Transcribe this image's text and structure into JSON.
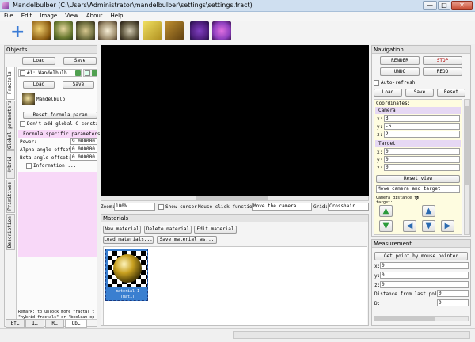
{
  "window": {
    "title": "Mandelbulber (C:\\Users\\Administrator\\mandelbulber\\settings\\settings.fract)",
    "btn_min": "—",
    "btn_max": "□",
    "btn_close": "✕"
  },
  "menu": [
    "File",
    "Edit",
    "Image",
    "View",
    "About",
    "Help"
  ],
  "toolbar": {
    "add_label": "+"
  },
  "objects": {
    "title": "Objects",
    "load": "Load",
    "save": "Save",
    "tabs_vertical": [
      "Fractals",
      "Global parameters",
      "Hybrid",
      "Primitives",
      "Description"
    ],
    "formula_tab1": "#1: Wandelbulb",
    "inner_load": "Load",
    "inner_save": "Save",
    "formula_name": "Mandelbulb",
    "reset_formula": "Reset formula param",
    "dont_add_global": "Don't add global C constant",
    "specific_title": "Formula specific parameters",
    "power_label": "Power:",
    "power_value": "9.000000",
    "alpha_label": "Alpha angle offset:",
    "alpha_value": "0.000000",
    "beta_label": "Beta angle offset:",
    "beta_value": "0.000000",
    "information": "Information ...",
    "remark": "Remark: to unlock more fractal t\n\"hybrid fractals\" or \"boolean op",
    "bottom_tabs": [
      "Ef…",
      "I…",
      "R…",
      "Ob…"
    ]
  },
  "render": {
    "zoom_label": "Zoom:",
    "zoom_value": "100%",
    "show_cursor": "Show cursor",
    "mouse_click_label": "Mouse click function:",
    "mouse_click_value": "Move the camera",
    "grid_label": "Grid:",
    "grid_value": "Crosshair"
  },
  "materials": {
    "title": "Materials",
    "new": "New material",
    "delete": "Delete material",
    "edit": "Edit material",
    "load": "Load materials...",
    "save": "Save material as...",
    "item_label_1": "material 1",
    "item_label_2": "[mat1]"
  },
  "navigation": {
    "title": "Navigation",
    "render": "RENDER",
    "stop": "STOP",
    "undo": "UNDO",
    "redo": "REDO",
    "auto_refresh": "Auto-refresh",
    "load": "Load",
    "save": "Save",
    "reset": "Reset",
    "coordinates": "Coordinates:",
    "camera": "Camera",
    "cam_x_label": "x:",
    "cam_x": "3",
    "cam_y_label": "y:",
    "cam_y": "-6",
    "cam_z_label": "z:",
    "cam_z": "2",
    "target": "Target",
    "tgt_x_label": "x:",
    "tgt_x": "0",
    "tgt_y_label": "y:",
    "tgt_y": "0",
    "tgt_z_label": "z:",
    "tgt_z": "0",
    "reset_view": "Reset view",
    "move_mode": "Move camera and target",
    "camera_distance_label": "Camera distance to target:",
    "camera_distance_value": "7"
  },
  "measurement": {
    "title": "Measurement",
    "get_point": "Get point by mouse pointer",
    "x_label": "x:",
    "x": "0",
    "y_label": "y:",
    "y": "0",
    "z_label": "z:",
    "z": "0",
    "distance_label": "Distance from last point:",
    "distance": "0",
    "d2_label": "D:",
    "d2": "0"
  }
}
